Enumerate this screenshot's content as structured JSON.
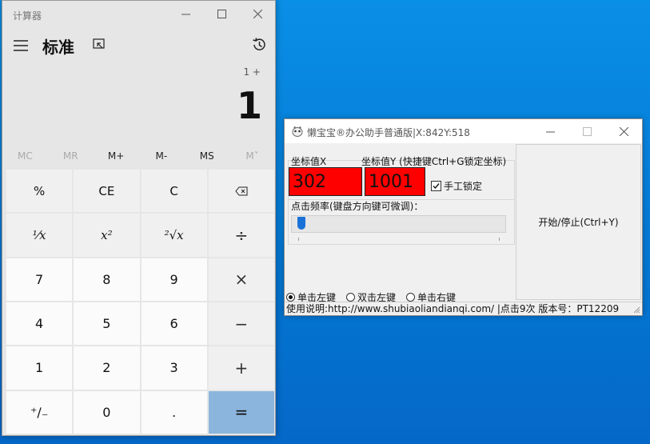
{
  "calculator": {
    "app_title": "计算器",
    "mode_title": "标准",
    "expression": "1 +",
    "display_value": "1",
    "memory_buttons": [
      {
        "label": "MC",
        "enabled": false
      },
      {
        "label": "MR",
        "enabled": false
      },
      {
        "label": "M+",
        "enabled": true
      },
      {
        "label": "M-",
        "enabled": true
      },
      {
        "label": "MS",
        "enabled": true
      },
      {
        "label": "M˅",
        "enabled": false
      }
    ],
    "keys": {
      "percent": "%",
      "ce": "CE",
      "c": "C",
      "reciprocal": "⅟x",
      "square": "x²",
      "sqrt": "²√x",
      "divide": "÷",
      "seven": "7",
      "eight": "8",
      "nine": "9",
      "multiply": "×",
      "four": "4",
      "five": "5",
      "six": "6",
      "minus": "−",
      "one": "1",
      "two": "2",
      "three": "3",
      "plus": "+",
      "negate": "⁺∕₋",
      "zero": "0",
      "decimal": ".",
      "equals": "="
    }
  },
  "helper": {
    "title": "懒宝宝®办公助手普通版|X:842Y:518",
    "label_x": "坐标值X",
    "label_y": "坐标值Y  (快捷键Ctrl+G锁定坐标)",
    "value_x": "302",
    "value_y": "1001",
    "lock_label": "手工锁定",
    "lock_checked": true,
    "freq_label": "点击频率(键盘方向键可微调)：",
    "freq_level": 0.02,
    "radios": [
      {
        "label": "单击左键",
        "selected": true
      },
      {
        "label": "双击左键",
        "selected": false
      },
      {
        "label": "单击右键",
        "selected": false
      }
    ],
    "start_stop_label": "开始/停止(Ctrl+Y)",
    "status_text": "使用说明:http://www.shubiaoliandianqi.com/ |点击9次 版本号：PT12209"
  }
}
